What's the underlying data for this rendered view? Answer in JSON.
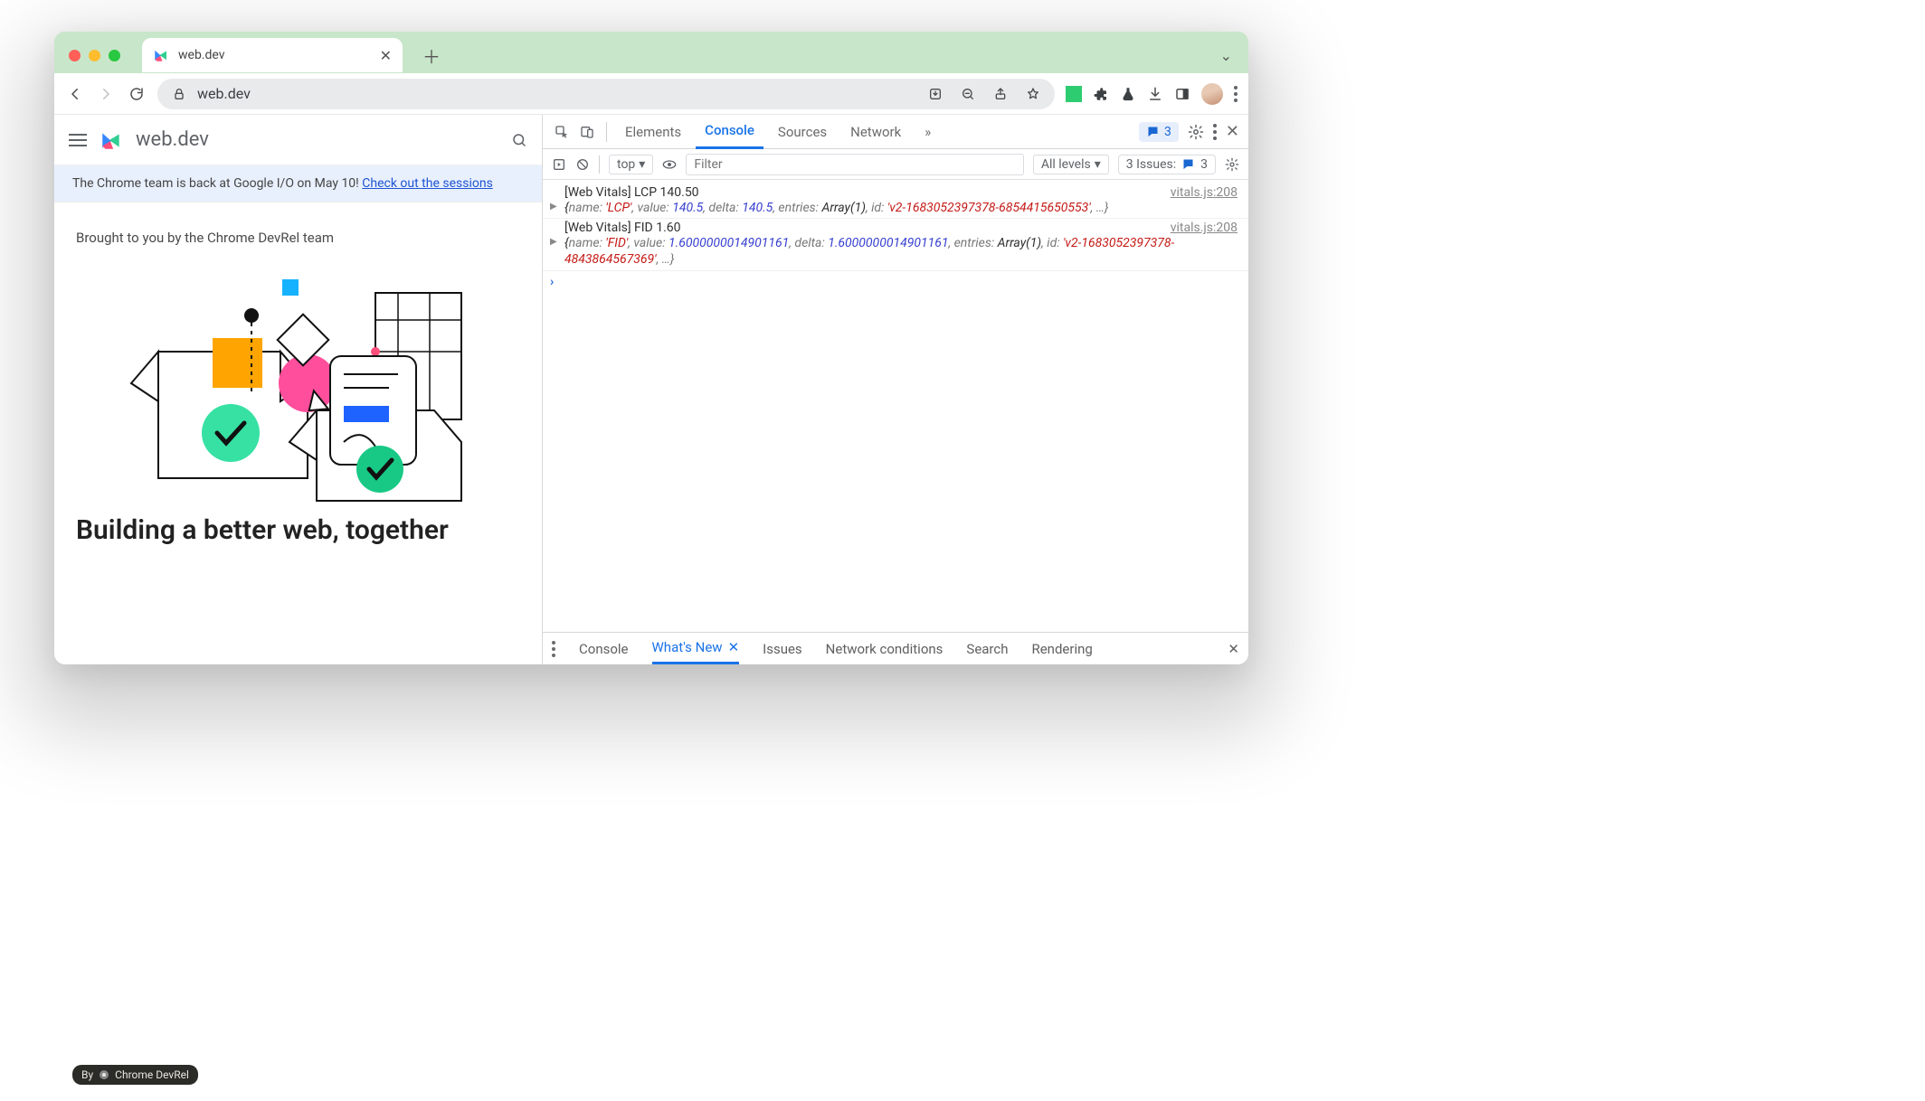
{
  "window": {
    "tab_title": "web.dev",
    "address": "web.dev"
  },
  "toolbar_ext_color": "#2ecc71",
  "page": {
    "site_name": "web.dev",
    "banner_text": "The Chrome team is back at Google I/O on May 10! ",
    "banner_link": "Check out the sessions",
    "hero_sub": "Brought to you by the Chrome DevRel team",
    "hero_title": "Building a better web, together"
  },
  "credit": {
    "prefix": "By",
    "author": "Chrome DevRel"
  },
  "devtools": {
    "tabs": [
      "Elements",
      "Console",
      "Sources",
      "Network"
    ],
    "active_tab": "Console",
    "more_indicator": "»",
    "msg_count": "3",
    "sub": {
      "context": "top",
      "filter_placeholder": "Filter",
      "levels": "All levels",
      "issues_label": "3 Issues:",
      "issues_count": "3"
    },
    "logs": [
      {
        "header": "[Web Vitals] LCP 140.50",
        "source": "vitals.js:208",
        "obj": {
          "name": "'LCP'",
          "value": "140.5",
          "delta": "140.5",
          "entries": "Array(1)",
          "id": "'v2-1683052397378-6854415650553'"
        }
      },
      {
        "header": "[Web Vitals] FID 1.60",
        "source": "vitals.js:208",
        "obj": {
          "name": "'FID'",
          "value": "1.6000000014901161",
          "delta": "1.6000000014901161",
          "entries": "Array(1)",
          "id": "'v2-1683052397378-4843864567369'"
        }
      }
    ],
    "drawer": [
      "Console",
      "What's New",
      "Issues",
      "Network conditions",
      "Search",
      "Rendering"
    ],
    "drawer_active": "What's New"
  }
}
